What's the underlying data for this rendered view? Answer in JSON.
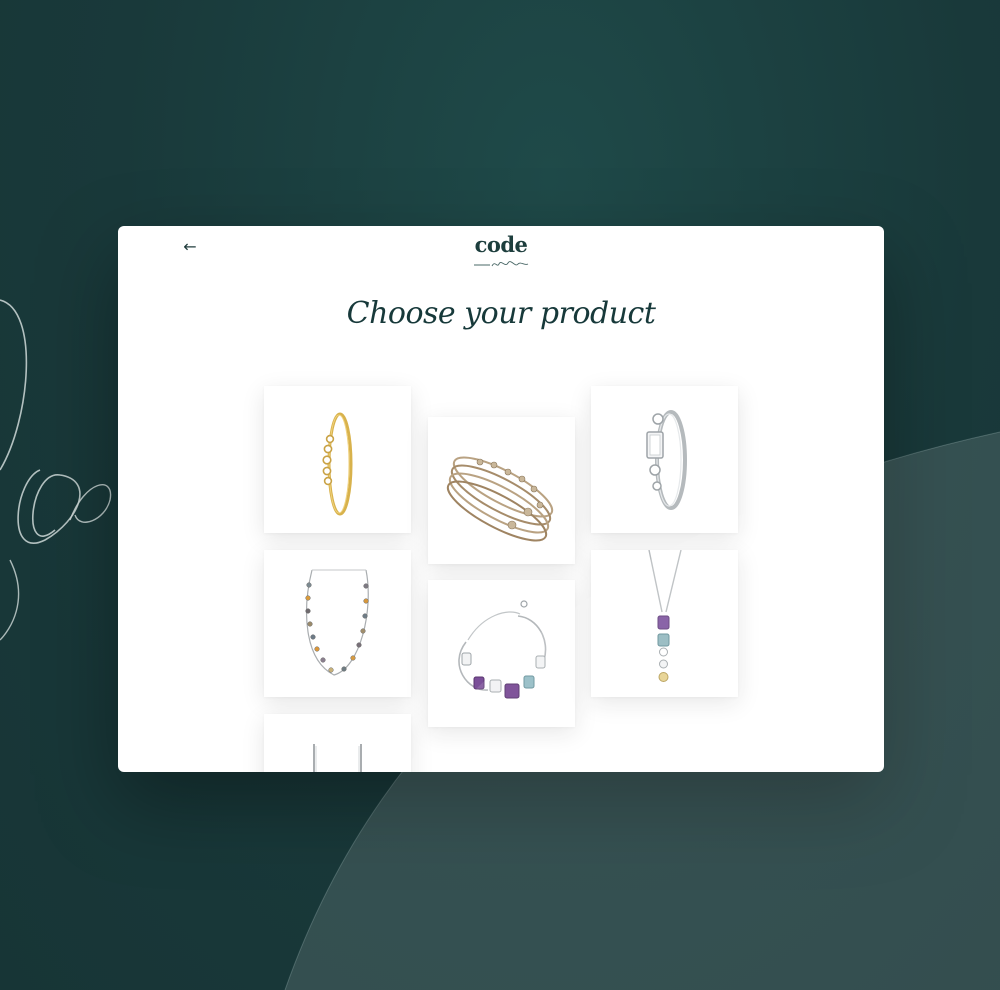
{
  "app": {
    "title": "Choose your product",
    "back_glyph": "←",
    "logo": {
      "word": "code"
    }
  },
  "products": [
    {
      "name": "gold stacking ring with stones",
      "icon": "ring-icon"
    },
    {
      "name": "set of stacked bangles",
      "icon": "bangle-icon"
    },
    {
      "name": "silver ring with rectangular stone",
      "icon": "ring-icon"
    },
    {
      "name": "gemstone station necklace",
      "icon": "necklace-icon"
    },
    {
      "name": "bracelet with colored gemstones",
      "icon": "bracelet-icon"
    },
    {
      "name": "drop pendant with gemstones",
      "icon": "pendant-icon"
    },
    {
      "name": "drop earrings",
      "icon": "earrings-icon"
    }
  ],
  "colors": {
    "background": "#19393a",
    "accent": "#1d3e3d",
    "window": "#ffffff"
  }
}
